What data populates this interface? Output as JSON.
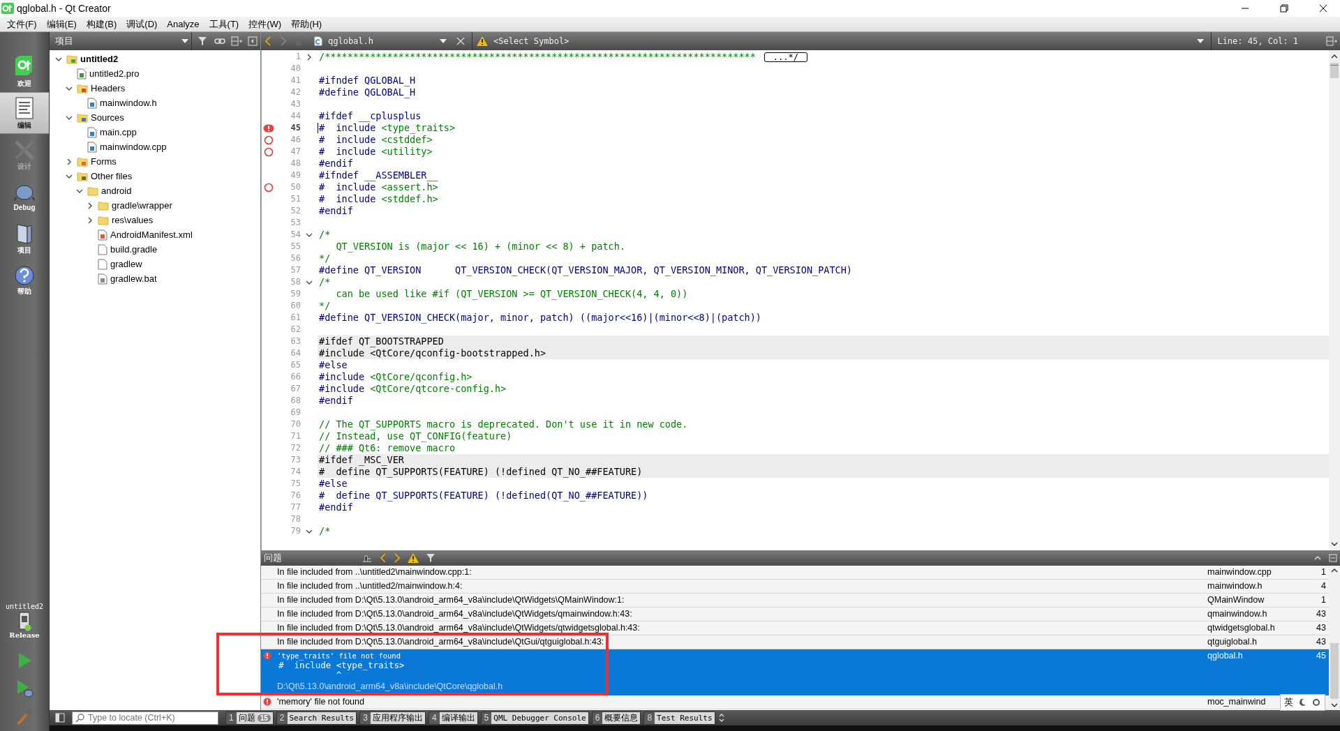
{
  "window": {
    "title": "qglobal.h - Qt Creator"
  },
  "menu": [
    "文件(F)",
    "编辑(E)",
    "构建(B)",
    "调试(D)",
    "Analyze",
    "工具(T)",
    "控件(W)",
    "帮助(H)"
  ],
  "modes": [
    {
      "label": "欢迎",
      "kind": "welcome",
      "selected": false,
      "disabled": false
    },
    {
      "label": "编辑",
      "kind": "edit",
      "selected": true,
      "disabled": false
    },
    {
      "label": "设计",
      "kind": "design",
      "selected": false,
      "disabled": true
    },
    {
      "label": "Debug",
      "kind": "debug",
      "selected": false,
      "disabled": false
    },
    {
      "label": "项目",
      "kind": "projects",
      "selected": false,
      "disabled": false
    },
    {
      "label": "帮助",
      "kind": "help",
      "selected": false,
      "disabled": false
    }
  ],
  "kit": {
    "project": "untitled2",
    "build": "Release"
  },
  "project_pane": {
    "title": "项目",
    "tree": [
      {
        "label": "untitled2",
        "kind": "project",
        "bold": true,
        "expanded": true,
        "children": [
          {
            "label": "untitled2.pro",
            "kind": "pro"
          },
          {
            "label": "Headers",
            "kind": "header-folder",
            "expanded": true,
            "children": [
              {
                "label": "mainwindow.h",
                "kind": "header"
              }
            ]
          },
          {
            "label": "Sources",
            "kind": "source-folder",
            "expanded": true,
            "children": [
              {
                "label": "main.cpp",
                "kind": "source"
              },
              {
                "label": "mainwindow.cpp",
                "kind": "source"
              }
            ]
          },
          {
            "label": "Forms",
            "kind": "form-folder",
            "expanded": false
          },
          {
            "label": "Other files",
            "kind": "other-folder",
            "expanded": true,
            "children": [
              {
                "label": "android",
                "kind": "folder",
                "expanded": true,
                "children": [
                  {
                    "label": "gradle\\wrapper",
                    "kind": "folder",
                    "expanded": false
                  },
                  {
                    "label": "res\\values",
                    "kind": "folder",
                    "expanded": false
                  },
                  {
                    "label": "AndroidManifest.xml",
                    "kind": "xml"
                  },
                  {
                    "label": "build.gradle",
                    "kind": "file"
                  },
                  {
                    "label": "gradlew",
                    "kind": "file"
                  },
                  {
                    "label": "gradlew.bat",
                    "kind": "bat"
                  }
                ]
              }
            ]
          }
        ]
      }
    ]
  },
  "editor": {
    "file": "qglobal.h",
    "symbol": "<Select Symbol>",
    "position": "Line: 45, Col: 1",
    "lines": [
      {
        "n": "1",
        "expanded": false,
        "segments": [
          {
            "text": "/****************************************************************************",
            "kind": "comment"
          }
        ],
        "folded": "...*/"
      },
      {
        "n": "40"
      },
      {
        "n": "41",
        "segments": [
          {
            "text": "#ifndef QGLOBAL_H",
            "kind": "pp"
          }
        ]
      },
      {
        "n": "42",
        "segments": [
          {
            "text": "#define QGLOBAL_H",
            "kind": "pp"
          }
        ]
      },
      {
        "n": "43"
      },
      {
        "n": "44",
        "segments": [
          {
            "text": "#ifdef __cplusplus",
            "kind": "pp"
          }
        ]
      },
      {
        "n": "45",
        "current": true,
        "error": true,
        "segments": [
          {
            "text": "#  include ",
            "kind": "pp"
          },
          {
            "text": "<type_traits>",
            "kind": "string"
          }
        ]
      },
      {
        "n": "46",
        "warning": true,
        "segments": [
          {
            "text": "#  include ",
            "kind": "pp"
          },
          {
            "text": "<cstddef>",
            "kind": "string"
          }
        ]
      },
      {
        "n": "47",
        "warning": true,
        "segments": [
          {
            "text": "#  include ",
            "kind": "pp"
          },
          {
            "text": "<utility>",
            "kind": "string"
          }
        ]
      },
      {
        "n": "48",
        "segments": [
          {
            "text": "#endif",
            "kind": "pp"
          }
        ]
      },
      {
        "n": "49",
        "segments": [
          {
            "text": "#ifndef __ASSEMBLER__",
            "kind": "pp"
          }
        ]
      },
      {
        "n": "50",
        "warning": true,
        "segments": [
          {
            "text": "#  include ",
            "kind": "pp"
          },
          {
            "text": "<assert.h>",
            "kind": "string"
          }
        ]
      },
      {
        "n": "51",
        "segments": [
          {
            "text": "#  include ",
            "kind": "pp"
          },
          {
            "text": "<stddef.h>",
            "kind": "string"
          }
        ]
      },
      {
        "n": "52",
        "segments": [
          {
            "text": "#endif",
            "kind": "pp"
          }
        ]
      },
      {
        "n": "53"
      },
      {
        "n": "54",
        "expanded": true,
        "segments": [
          {
            "text": "/*",
            "kind": "comment"
          }
        ]
      },
      {
        "n": "55",
        "segments": [
          {
            "text": "   QT_VERSION is (major << 16) + (minor << 8) + patch.",
            "kind": "comment"
          }
        ]
      },
      {
        "n": "56",
        "segments": [
          {
            "text": "*/",
            "kind": "comment"
          }
        ]
      },
      {
        "n": "57",
        "segments": [
          {
            "text": "#define QT_VERSION      QT_VERSION_CHECK(QT_VERSION_MAJOR, QT_VERSION_MINOR, QT_VERSION_PATCH)",
            "kind": "pp"
          }
        ]
      },
      {
        "n": "58",
        "expanded": true,
        "segments": [
          {
            "text": "/*",
            "kind": "comment"
          }
        ]
      },
      {
        "n": "59",
        "segments": [
          {
            "text": "   can be used like #if (QT_VERSION >= QT_VERSION_CHECK(4, 4, 0))",
            "kind": "comment"
          }
        ]
      },
      {
        "n": "60",
        "segments": [
          {
            "text": "*/",
            "kind": "comment"
          }
        ]
      },
      {
        "n": "61",
        "segments": [
          {
            "text": "#define QT_VERSION_CHECK(major, minor, patch) ((major<<16)|(minor<<8)|(patch))",
            "kind": "pp"
          }
        ]
      },
      {
        "n": "62"
      },
      {
        "n": "63",
        "shaded": true,
        "segments": [
          {
            "text": "#ifdef QT_BOOTSTRAPPED",
            "kind": "plain"
          }
        ]
      },
      {
        "n": "64",
        "shaded": true,
        "segments": [
          {
            "text": "#include <QtCore/qconfig-bootstrapped.h>",
            "kind": "plain"
          }
        ]
      },
      {
        "n": "65",
        "segments": [
          {
            "text": "#else",
            "kind": "pp"
          }
        ]
      },
      {
        "n": "66",
        "segments": [
          {
            "text": "#include ",
            "kind": "pp"
          },
          {
            "text": "<QtCore/qconfig.h>",
            "kind": "string"
          }
        ]
      },
      {
        "n": "67",
        "segments": [
          {
            "text": "#include ",
            "kind": "pp"
          },
          {
            "text": "<QtCore/qtcore-config.h>",
            "kind": "string"
          }
        ]
      },
      {
        "n": "68",
        "segments": [
          {
            "text": "#endif",
            "kind": "pp"
          }
        ]
      },
      {
        "n": "69"
      },
      {
        "n": "70",
        "segments": [
          {
            "text": "// The QT_SUPPORTS macro is deprecated. Don't use it in new code.",
            "kind": "comment"
          }
        ]
      },
      {
        "n": "71",
        "segments": [
          {
            "text": "// Instead, use QT_CONFIG(feature)",
            "kind": "comment"
          }
        ]
      },
      {
        "n": "72",
        "segments": [
          {
            "text": "// ### Qt6: remove macro",
            "kind": "comment"
          }
        ]
      },
      {
        "n": "73",
        "shaded": true,
        "segments": [
          {
            "text": "#ifdef _MSC_VER",
            "kind": "plain"
          }
        ]
      },
      {
        "n": "74",
        "shaded": true,
        "segments": [
          {
            "text": "#  define QT_SUPPORTS(FEATURE) (!defined QT_NO_##FEATURE)",
            "kind": "plain"
          }
        ]
      },
      {
        "n": "75",
        "segments": [
          {
            "text": "#else",
            "kind": "pp"
          }
        ]
      },
      {
        "n": "76",
        "segments": [
          {
            "text": "#  define QT_SUPPORTS(FEATURE) (!defined(QT_NO_##FEATURE))",
            "kind": "pp"
          }
        ]
      },
      {
        "n": "77",
        "segments": [
          {
            "text": "#endif",
            "kind": "pp"
          }
        ]
      },
      {
        "n": "78"
      },
      {
        "n": "79",
        "expanded": true,
        "segments": [
          {
            "text": "/*",
            "kind": "comment"
          }
        ]
      }
    ]
  },
  "issues": {
    "title": "问题",
    "rows": [
      {
        "kind": "info",
        "selected": false,
        "text": "In file included from ..\\untitled2\\mainwindow.cpp:1:",
        "file": "mainwindow.cpp",
        "line": "1"
      },
      {
        "kind": "info",
        "selected": false,
        "text": "In file included from ..\\untitled2/mainwindow.h:4:",
        "file": "mainwindow.h",
        "line": "4"
      },
      {
        "kind": "info",
        "selected": false,
        "text": "In file included from D:\\Qt\\5.13.0\\android_arm64_v8a\\include\\QtWidgets\\QMainWindow:1:",
        "file": "QMainWindow",
        "line": "1"
      },
      {
        "kind": "info",
        "selected": false,
        "text": "In file included from D:\\Qt\\5.13.0\\android_arm64_v8a\\include\\QtWidgets/qmainwindow.h:43:",
        "file": "qmainwindow.h",
        "line": "43"
      },
      {
        "kind": "info",
        "selected": false,
        "text": "In file included from D:\\Qt\\5.13.0\\android_arm64_v8a\\include\\QtWidgets/qtwidgetsglobal.h:43:",
        "file": "qtwidgetsglobal.h",
        "line": "43"
      },
      {
        "kind": "info",
        "selected": false,
        "text": "In file included from D:\\Qt\\5.13.0\\android_arm64_v8a\\include\\QtGui/qtguiglobal.h:43:",
        "file": "qtguiglobal.h",
        "line": "43"
      },
      {
        "kind": "error",
        "selected": true,
        "text": "'type_traits' file not found",
        "details": [
          "#  include <type_traits>",
          "           ^"
        ],
        "path": "D:\\Qt\\5.13.0\\android_arm64_v8a\\include\\QtCore\\qglobal.h",
        "file": "qglobal.h",
        "line": "45"
      },
      {
        "kind": "error",
        "selected": false,
        "text": "'memory' file not found",
        "file": "moc_mainwind"
      }
    ]
  },
  "locator": {
    "placeholder": "Type to locate (Ctrl+K)"
  },
  "output_tabs": [
    {
      "number": "1",
      "label": "问题",
      "badge": "15",
      "mono": false
    },
    {
      "number": "2",
      "label": "Search Results",
      "mono": true
    },
    {
      "number": "3",
      "label": "应用程序输出",
      "mono": false
    },
    {
      "number": "4",
      "label": "编译输出",
      "mono": false
    },
    {
      "number": "5",
      "label": "QML Debugger Console",
      "mono": true
    },
    {
      "number": "6",
      "label": "概要信息",
      "mono": false
    },
    {
      "number": "8",
      "label": "Test Results",
      "mono": true
    }
  ],
  "ime_toolbar": {
    "label": "英"
  }
}
